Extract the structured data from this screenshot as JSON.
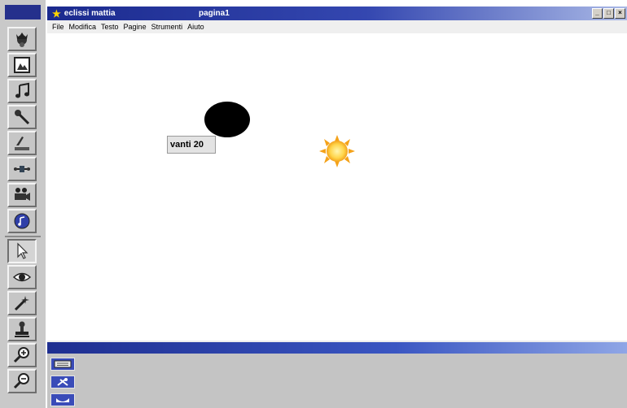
{
  "window": {
    "app_title": "eclissi mattia",
    "page_title": "pagina1"
  },
  "menu": [
    "File",
    "Modifica",
    "Testo",
    "Pagine",
    "Strumenti",
    "Aiuto"
  ],
  "canvas": {
    "button_label": "vanti 20"
  },
  "toolbar": {
    "tools": [
      {
        "icon": "character-icon"
      },
      {
        "icon": "image-icon"
      },
      {
        "icon": "music-note-icon"
      },
      {
        "icon": "microphone-icon"
      },
      {
        "icon": "scanner-icon"
      },
      {
        "icon": "slider-icon"
      },
      {
        "icon": "video-camera-icon"
      },
      {
        "icon": "sound-icon"
      },
      {
        "icon": "pointer-icon"
      },
      {
        "icon": "eye-icon"
      },
      {
        "icon": "magic-wand-icon"
      },
      {
        "icon": "stamp-icon"
      },
      {
        "icon": "zoom-in-icon"
      },
      {
        "icon": "zoom-out-icon"
      }
    ]
  },
  "bottom_panel": {
    "icons": [
      "keyboard-icon",
      "tools-icon",
      "tray-icon"
    ]
  }
}
